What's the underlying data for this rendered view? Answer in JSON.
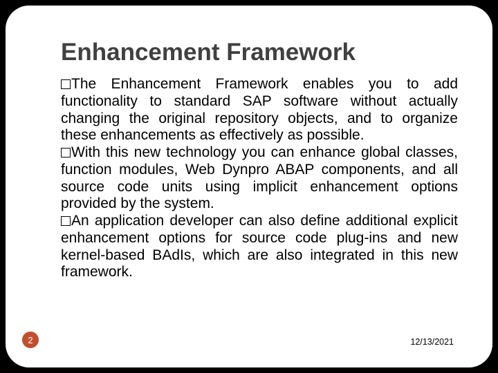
{
  "title": "Enhancement Framework",
  "bullets": [
    "The Enhancement Framework enables you to add functionality to standard SAP software without actually changing the original repository objects, and to organize these enhancements as effectively as possible.",
    "With this new technology you can enhance global classes, function modules, Web Dynpro ABAP components, and all source code units using implicit enhancement options provided by the system.",
    "An application developer can also define additional explicit enhancement options for source code plug-ins and new kernel-based BAdIs, which are also integrated in this new framework."
  ],
  "page_number": "2",
  "date": "12/13/2021"
}
